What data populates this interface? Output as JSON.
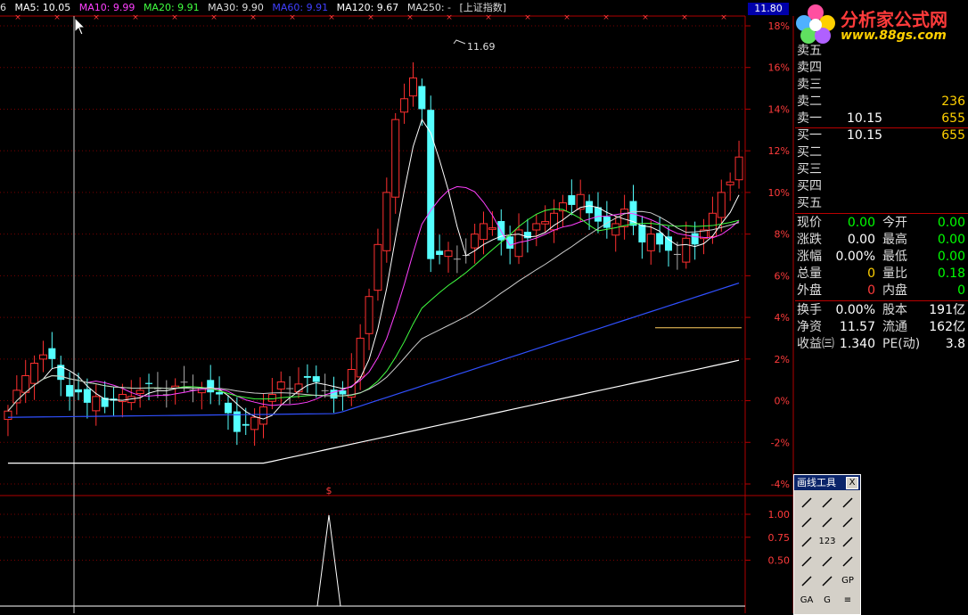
{
  "topbar": {
    "prefix": "6",
    "ma5": "MA5: 10.05",
    "ma10": "MA10: 9.99",
    "ma20": "MA20: 9.91",
    "ma30": "MA30: 9.90",
    "ma60": "MA60: 9.91",
    "ma120": "MA120: 9.67",
    "ma250": "MA250: -",
    "index": "[上证指数]",
    "colors": {
      "ma5": "#ffffff",
      "ma10": "#ff40ff",
      "ma20": "#40ff40",
      "ma30": "#dddddd",
      "ma60": "#4040ff",
      "ma120": "#ffffff",
      "ma250": "#dddddd"
    }
  },
  "price_tag": "11.80",
  "logo": {
    "title": "分析家公式网",
    "url": "www.88gs.com"
  },
  "sell_orders": [
    {
      "label": "卖五",
      "price": "",
      "vol": ""
    },
    {
      "label": "卖四",
      "price": "",
      "vol": ""
    },
    {
      "label": "卖三",
      "price": "",
      "vol": ""
    },
    {
      "label": "卖二",
      "price": "",
      "vol": "236"
    },
    {
      "label": "卖一",
      "price": "10.15",
      "vol": "655"
    }
  ],
  "buy_orders": [
    {
      "label": "买一",
      "price": "10.15",
      "vol": "655"
    },
    {
      "label": "买二",
      "price": "",
      "vol": ""
    },
    {
      "label": "买三",
      "price": "",
      "vol": ""
    },
    {
      "label": "买四",
      "price": "",
      "vol": ""
    },
    {
      "label": "买五",
      "price": "",
      "vol": ""
    }
  ],
  "stats1": [
    {
      "l1": "现价",
      "v1": "0.00",
      "c1": "green",
      "l2": "今开",
      "v2": "0.00",
      "c2": "green"
    },
    {
      "l1": "涨跌",
      "v1": "0.00",
      "c1": "white",
      "l2": "最高",
      "v2": "0.00",
      "c2": "green"
    },
    {
      "l1": "涨幅",
      "v1": "0.00%",
      "c1": "white",
      "l2": "最低",
      "v2": "0.00",
      "c2": "green"
    },
    {
      "l1": "总量",
      "v1": "0",
      "c1": "yellow",
      "l2": "量比",
      "v2": "0.18",
      "c2": "green"
    },
    {
      "l1": "外盘",
      "v1": "0",
      "c1": "red",
      "l2": "内盘",
      "v2": "0",
      "c2": "green"
    }
  ],
  "stats2": [
    {
      "l1": "换手",
      "v1": "0.00%",
      "c1": "white",
      "l2": "股本",
      "v2": "191亿",
      "c2": "white"
    },
    {
      "l1": "净资",
      "v1": "11.57",
      "c1": "white",
      "l2": "流通",
      "v2": "162亿",
      "c2": "white"
    },
    {
      "l1": "收益㈢",
      "v1": "1.340",
      "c1": "white",
      "l2": "PE(动)",
      "v2": "3.8",
      "c2": "white"
    }
  ],
  "toolbox": {
    "title": "画线工具",
    "close": "X",
    "tools": [
      "pointer-icon",
      "line-icon",
      "ray-icon",
      "arrow-icon",
      "segment-icon",
      "hline-icon",
      "vline-icon",
      "fib-icon",
      "channel-icon",
      "parallel-icon",
      "trend-icon",
      "arc-icon",
      "circle-icon",
      "no-icon",
      "gp-icon",
      "ga-icon",
      "g-icon",
      "list-icon"
    ],
    "tool_labels": [
      "",
      "",
      "",
      "",
      "",
      "",
      "",
      "123",
      "",
      "",
      "",
      "",
      "",
      "",
      "GP",
      "GA",
      "G",
      "≡"
    ]
  },
  "chart_data": {
    "type": "candlestick",
    "y_axis_ticks": [
      "18%",
      "16%",
      "14%",
      "12%",
      "10%",
      "8%",
      "6%",
      "4%",
      "2%",
      "0%",
      "-2%",
      "-4%"
    ],
    "y_axis_values": [
      18,
      16,
      14,
      12,
      10,
      8,
      6,
      4,
      2,
      0,
      -2,
      -4
    ],
    "lower_ticks": [
      "1.00",
      "0.75",
      "0.50"
    ],
    "lower_values": [
      1.0,
      0.75,
      0.5
    ],
    "peak_label": "11.69",
    "signal_marker": "$",
    "colors": {
      "up": "#ff3030",
      "down": "#55ffff",
      "flat": "#aaaaaa",
      "grid": "#7a0000",
      "axis": "#b00000"
    }
  }
}
